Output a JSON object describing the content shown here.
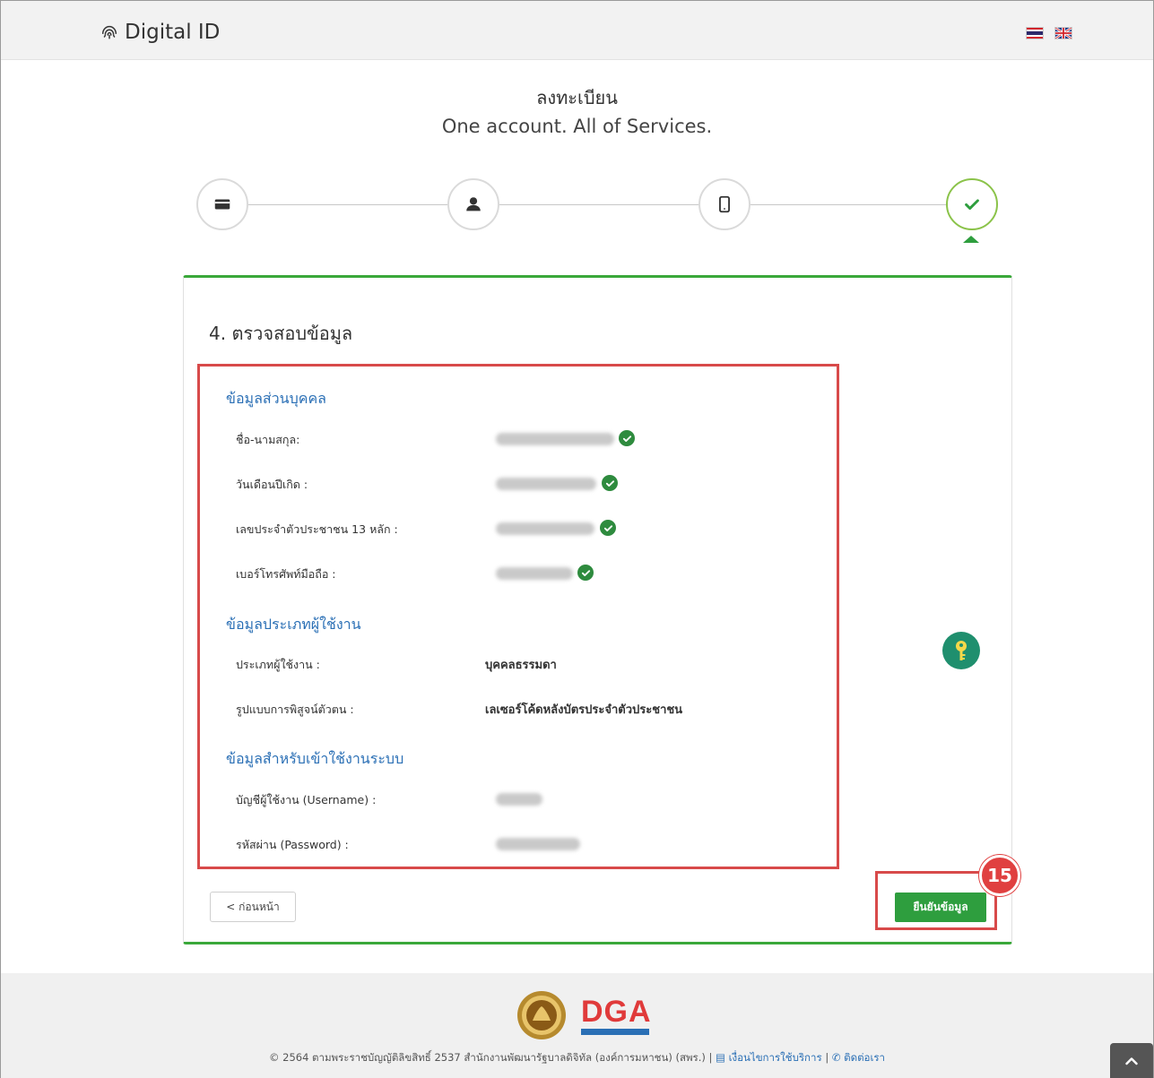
{
  "header": {
    "brand_name": "Digital ID",
    "brand_icon": "fingerprint-icon",
    "languages": [
      "th",
      "en"
    ]
  },
  "page": {
    "title_th": "ลงทะเบียน",
    "title_en": "One account. All of Services."
  },
  "stepper": {
    "steps": [
      {
        "icon": "id-card-icon",
        "state": "complete"
      },
      {
        "icon": "user-icon",
        "state": "complete"
      },
      {
        "icon": "mobile-phone-icon",
        "state": "complete"
      },
      {
        "icon": "checkmark-icon",
        "state": "current"
      }
    ]
  },
  "review": {
    "section_title": "4. ตรวจสอบข้อมูล",
    "personal": {
      "heading": "ข้อมูลส่วนบุคคล",
      "name_label": "ชื่อ-นามสกุล:",
      "birth_label": "วันเดือนปีเกิด :",
      "citizen_id_label": "เลขประจำตัวประชาชน 13 หลัก :",
      "phone_label": "เบอร์โทรศัพท์มือถือ :"
    },
    "user_type": {
      "heading": "ข้อมูลประเภทผู้ใช้งาน",
      "type_label": "ประเภทผู้ใช้งาน :",
      "type_value": "บุคคลธรรมดา",
      "verify_label": "รูปแบบการพิสูจน์ตัวตน :",
      "verify_value": "เลเซอร์โค้ดหลังบัตรประจำตัวประชาชน"
    },
    "login": {
      "heading": "ข้อมูลสำหรับเข้าใช้งานระบบ",
      "username_label": "บัญชีผู้ใช้งาน (Username) :",
      "password_label": "รหัสผ่าน (Password) :"
    }
  },
  "actions": {
    "back_label": "< ก่อนหน้า",
    "confirm_label": "ยืนยันข้อมูล",
    "step_badge": "15"
  },
  "footer": {
    "logo_text": "DGA",
    "copyright": "© 2564 ตามพระราชบัญญัติลิขสิทธิ์ 2537 สำนักงานพัฒนารัฐบาลดิจิทัล (องค์การมหาชน) (สพร.) | ",
    "terms_label": "เงื่อนไขการใช้บริการ",
    "separator": " | ",
    "contact_label": "ติดต่อเรา"
  },
  "colors": {
    "accent_green": "#2e9e3e",
    "highlight_red": "#d84a4a",
    "link_blue": "#2a6fb5"
  }
}
